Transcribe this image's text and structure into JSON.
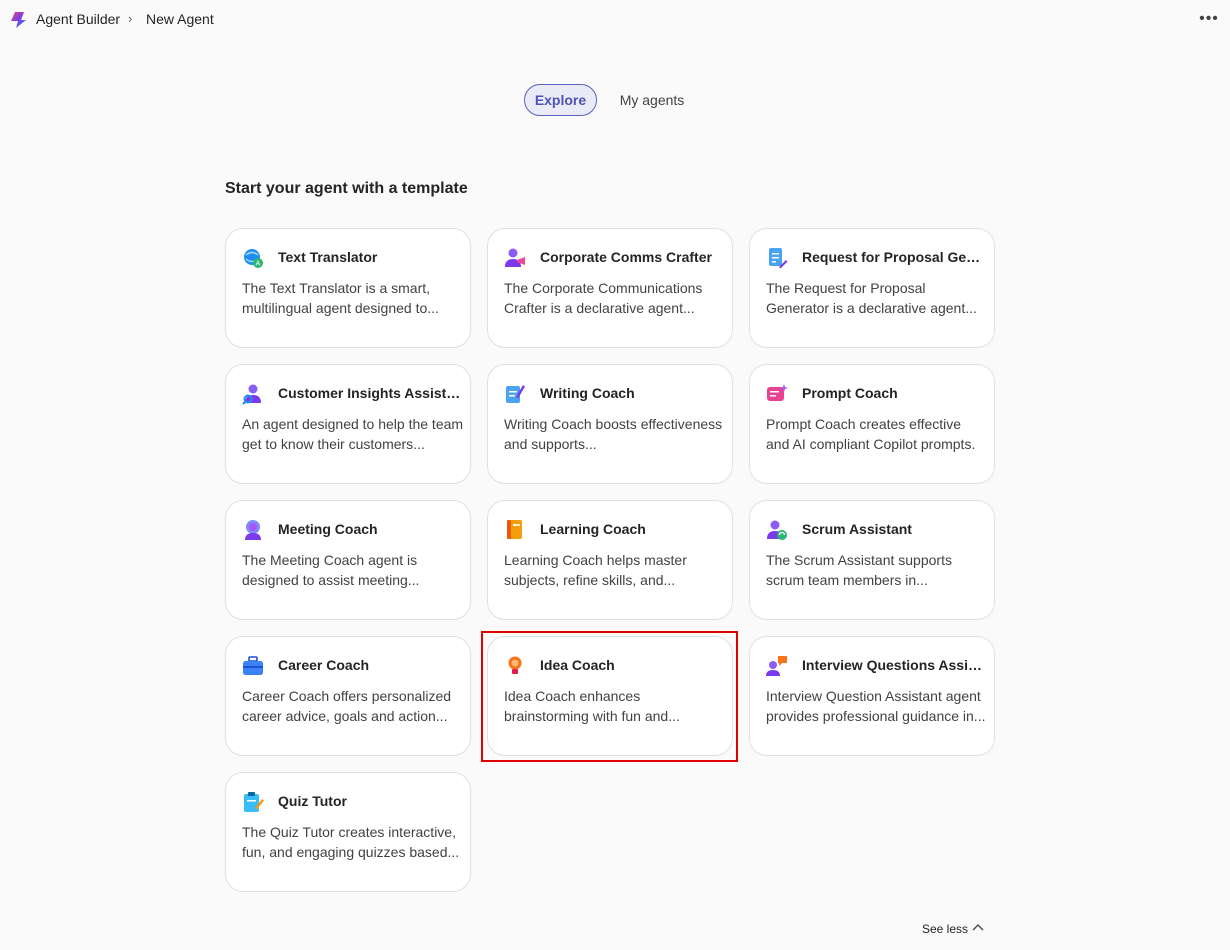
{
  "header": {
    "breadcrumb": [
      "Agent Builder",
      "New Agent"
    ],
    "brand_colors": [
      "#7b3fe4",
      "#e8437e",
      "#1f8ef1"
    ]
  },
  "tabs": [
    {
      "label": "Explore",
      "selected": true
    },
    {
      "label": "My agents",
      "selected": false
    }
  ],
  "section_title": "Start your agent with a template",
  "templates": [
    {
      "title": "Text Translator",
      "description": "The Text Translator is a smart, multilingual agent designed to...",
      "icon": "globe-translate-icon"
    },
    {
      "title": "Corporate Comms Crafter",
      "description": "The Corporate Communications Crafter is a declarative agent...",
      "icon": "person-megaphone-icon"
    },
    {
      "title": "Request for Proposal Generator",
      "description": "The Request for Proposal Generator is a declarative agent...",
      "icon": "document-edit-icon"
    },
    {
      "title": "Customer Insights Assistant",
      "description": "An agent designed to help the team get to know their customers...",
      "icon": "person-search-icon"
    },
    {
      "title": "Writing Coach",
      "description": "Writing Coach boosts effectiveness and supports...",
      "icon": "document-pen-icon"
    },
    {
      "title": "Prompt Coach",
      "description": "Prompt Coach creates effective and AI compliant Copilot prompts.",
      "icon": "prompt-sparkle-icon"
    },
    {
      "title": "Meeting Coach",
      "description": "The Meeting Coach agent is designed to assist meeting...",
      "icon": "person-headset-icon"
    },
    {
      "title": "Learning Coach",
      "description": "Learning Coach helps master subjects, refine skills, and...",
      "icon": "book-icon"
    },
    {
      "title": "Scrum Assistant",
      "description": "The Scrum Assistant supports scrum team members in...",
      "icon": "person-sync-icon"
    },
    {
      "title": "Career Coach",
      "description": "Career Coach offers personalized career advice, goals and action...",
      "icon": "briefcase-icon"
    },
    {
      "title": "Idea Coach",
      "description": "Idea Coach enhances brainstorming with fun and...",
      "icon": "lightbulb-icon"
    },
    {
      "title": "Interview Questions Assistant",
      "description": "Interview Question Assistant agent provides professional guidance in...",
      "icon": "person-chat-icon"
    },
    {
      "title": "Quiz Tutor",
      "description": "The Quiz Tutor creates interactive, fun, and engaging quizzes based...",
      "icon": "clipboard-pen-icon"
    }
  ],
  "footer": {
    "see_less_label": "See less"
  },
  "accent_color": "#5b5fc7",
  "highlight_color": "#e00000"
}
